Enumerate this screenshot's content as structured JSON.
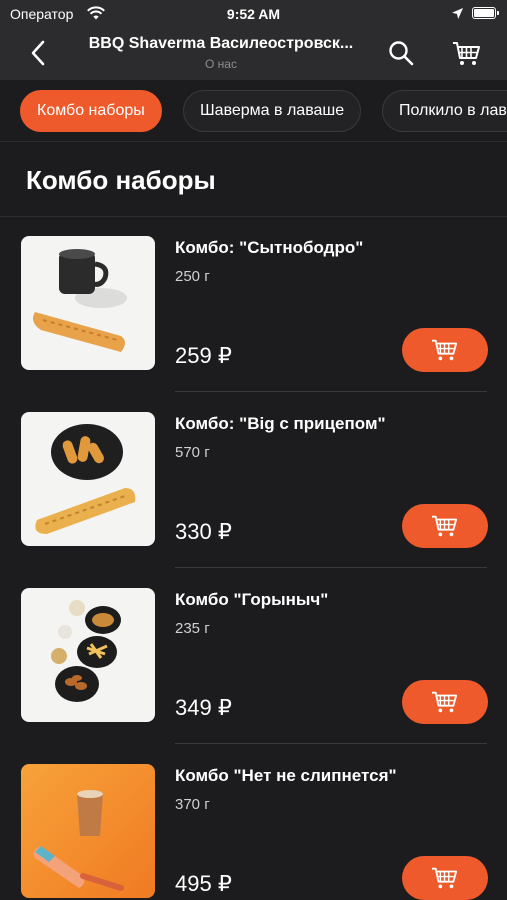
{
  "status_bar": {
    "carrier": "Оператор",
    "time": "9:52 AM"
  },
  "nav": {
    "title": "BBQ Shaverma Василеостровск...",
    "subtitle": "О нас"
  },
  "tabs": [
    {
      "label": "Комбо наборы",
      "active": true
    },
    {
      "label": "Шаверма в лаваше",
      "active": false
    },
    {
      "label": "Полкило в лаваше",
      "active": false
    }
  ],
  "section": {
    "title": "Комбо наборы"
  },
  "products": [
    {
      "name": "Комбо: \"Сытнободро\"",
      "weight": "250 г",
      "price": "259 ₽"
    },
    {
      "name": "Комбо: \"Big с прицепом\"",
      "weight": "570 г",
      "price": "330 ₽"
    },
    {
      "name": "Комбо \"Горыныч\"",
      "weight": "235 г",
      "price": "349 ₽"
    },
    {
      "name": "Комбо \"Нет не слипнется\"",
      "weight": "370 г",
      "price": "495 ₽"
    }
  ],
  "colors": {
    "accent": "#ee5a2b",
    "background": "#1c1c1e",
    "bar": "#2c2c2e"
  }
}
